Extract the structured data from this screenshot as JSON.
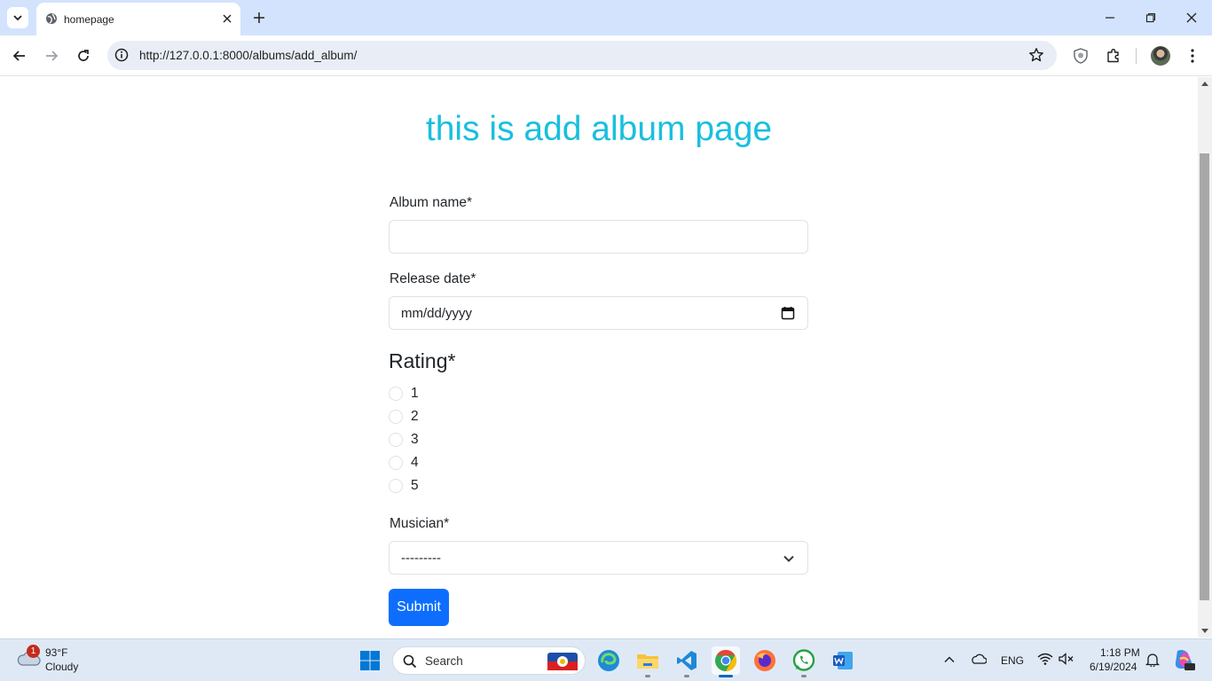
{
  "browser": {
    "tab_title": "homepage",
    "url": "http://127.0.0.1:8000/albums/add_album/"
  },
  "page": {
    "heading": "this is add album page",
    "album_name_label": "Album name*",
    "release_date_label": "Release date*",
    "release_date_placeholder": "mm/dd/yyyy",
    "rating_heading": "Rating*",
    "rating_options": [
      "1",
      "2",
      "3",
      "4",
      "5"
    ],
    "musician_label": "Musician*",
    "musician_selected": "---------",
    "submit_label": "Submit"
  },
  "taskbar": {
    "weather_badge": "1",
    "temperature": "93°F",
    "condition": "Cloudy",
    "search_label": "Search",
    "language": "ENG",
    "time": "1:18 PM",
    "date": "6/19/2024"
  },
  "colors": {
    "heading": "#19bfdf",
    "submit": "#0d6efd",
    "tabstrip": "#d3e3fd"
  }
}
